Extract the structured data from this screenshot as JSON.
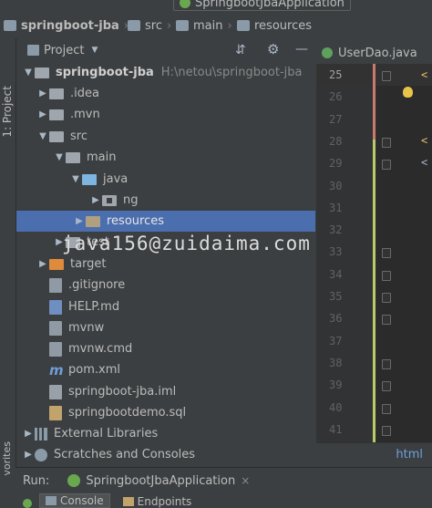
{
  "navbar": {
    "run_config": "SpringbootJbaApplication",
    "breadcrumbs": [
      "springboot-jba",
      "src",
      "main",
      "resources"
    ]
  },
  "tool_stripe": {
    "project_label": "1: Project",
    "favorites_label": "vorites"
  },
  "project_panel": {
    "title": "Project",
    "view_dropdown_icon": "triangle-down-icon",
    "header_icons": [
      "collapse-icon",
      "gear-icon",
      "minimize-icon"
    ]
  },
  "tree": [
    {
      "label": "springboot-jba",
      "path": "H:\\netou\\springboot-jba",
      "bold": true,
      "expanded": true,
      "icon": "folder"
    },
    {
      "label": ".idea",
      "expanded": false,
      "icon": "folder"
    },
    {
      "label": ".mvn",
      "expanded": false,
      "icon": "folder"
    },
    {
      "label": "src",
      "expanded": true,
      "icon": "folder"
    },
    {
      "label": "main",
      "expanded": true,
      "icon": "folder"
    },
    {
      "label": "java",
      "expanded": true,
      "icon": "source-folder"
    },
    {
      "label": "ng",
      "expanded": false,
      "icon": "package"
    },
    {
      "label": "resources",
      "expanded": false,
      "icon": "resources-folder",
      "selected": true
    },
    {
      "label": "test",
      "expanded": false,
      "icon": "folder"
    },
    {
      "label": "target",
      "expanded": false,
      "icon": "excluded-folder"
    },
    {
      "label": ".gitignore",
      "icon": "file"
    },
    {
      "label": "HELP.md",
      "icon": "markdown-file"
    },
    {
      "label": "mvnw",
      "icon": "file"
    },
    {
      "label": "mvnw.cmd",
      "icon": "file"
    },
    {
      "label": "pom.xml",
      "icon": "maven-file"
    },
    {
      "label": "springboot-jba.iml",
      "icon": "iml-file"
    },
    {
      "label": "springbootdemo.sql",
      "icon": "sql-file"
    },
    {
      "label": "External Libraries",
      "expanded": false,
      "icon": "library"
    },
    {
      "label": "Scratches and Consoles",
      "expanded": false,
      "icon": "scratches"
    }
  ],
  "watermark": "java156@zuidaima.com",
  "editor": {
    "tab_label": "UserDao.java",
    "line_numbers": [
      "25",
      "26",
      "27",
      "28",
      "29",
      "30",
      "31",
      "32",
      "33",
      "34",
      "35",
      "36",
      "37",
      "38",
      "39",
      "40",
      "41"
    ],
    "code_fragments": [
      "<",
      "<",
      "<"
    ],
    "footer_label": "html"
  },
  "run_bar": {
    "label": "Run:",
    "config": "SpringbootJbaApplication",
    "close": "×",
    "tabs": [
      "Console",
      "Endpoints"
    ]
  },
  "colors": {
    "selection": "#4b6eaf",
    "panel": "#3c3f41",
    "editor": "#2b2b2b"
  }
}
